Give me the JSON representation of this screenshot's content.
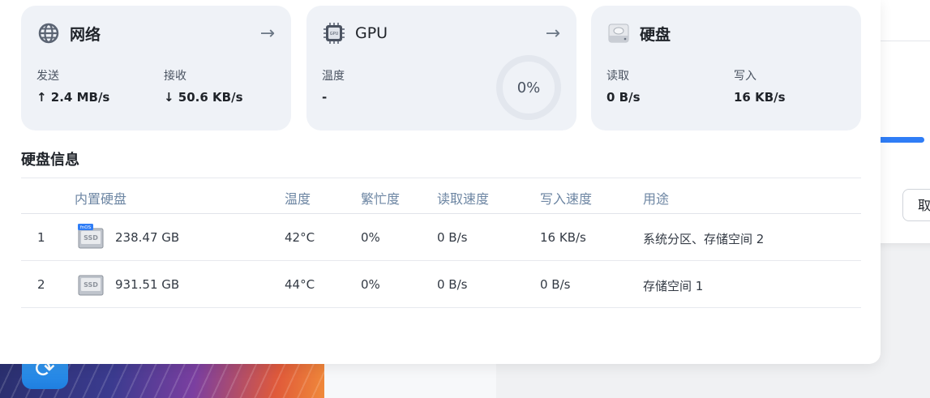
{
  "cards": {
    "network": {
      "title": "网络",
      "send_label": "发送",
      "send_value": "2.4 MB/s",
      "recv_label": "接收",
      "recv_value": "50.6 KB/s"
    },
    "gpu": {
      "title": "GPU",
      "chip_text": "GPU",
      "temp_label": "温度",
      "temp_value": "-",
      "usage": "0%"
    },
    "disk": {
      "title": "硬盘",
      "read_label": "读取",
      "read_value": "0 B/s",
      "write_label": "写入",
      "write_value": "16 KB/s"
    }
  },
  "disk_info": {
    "title": "硬盘信息",
    "columns": [
      "内置硬盘",
      "温度",
      "繁忙度",
      "读取速度",
      "写入速度",
      "用途"
    ],
    "rows": [
      {
        "index": "1",
        "badge": "fnOS",
        "ssd": "SSD",
        "size": "238.47 GB",
        "temp": "42°C",
        "busy": "0%",
        "read": "0 B/s",
        "write": "16 KB/s",
        "usage": "系统分区、存储空间 2"
      },
      {
        "index": "2",
        "ssd": "SSD",
        "size": "931.51 GB",
        "temp": "44°C",
        "busy": "0%",
        "read": "0 B/s",
        "write": "0 B/s",
        "usage": "存储空间 1"
      }
    ]
  },
  "background": {
    "cancel_label": "取"
  },
  "colors": {
    "accent": "#2f7df6",
    "card_bg": "#eff2f7",
    "header_text": "#6d86a3"
  }
}
